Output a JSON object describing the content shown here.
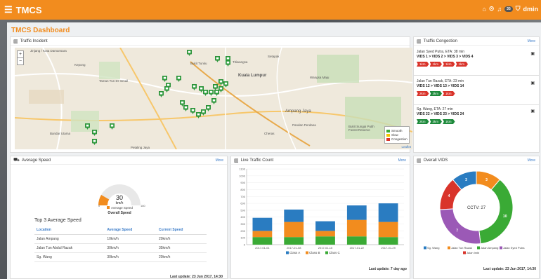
{
  "app": {
    "title": "TMCS",
    "user": "dmin",
    "notif_count": "35"
  },
  "page": {
    "title": "TMCS Dashboard"
  },
  "incident": {
    "title": "Traffic Incident",
    "map_labels": [
      "Jinjang / Kota Damansara",
      "Kuala Lumpur",
      "Ampang Jaya",
      "Petaling Jaya",
      "Taman Tun Dr Ismail",
      "Bukit Tunku",
      "Setapak",
      "Cheras",
      "Titiwangsa",
      "Pandan Perdana",
      "Bukit Sungai Putih Forest Reserve",
      "Kepong",
      "Wangsa Maju",
      "Bandar Utama"
    ],
    "legend": [
      {
        "label": "Smooth",
        "color": "#3aaa35"
      },
      {
        "label": "Slow",
        "color": "#f2c500"
      },
      {
        "label": "Congestion",
        "color": "#d9342b"
      }
    ],
    "attribution": "Leaflet"
  },
  "congestion": {
    "title": "Traffic Congestion",
    "more": "More",
    "items": [
      {
        "title": "Jalan Syed Putra, ETA: 38 min",
        "vids": "VIDS 1 >  VIDS 2 >  VIDS 3 >  VIDS 4",
        "segments": [
          {
            "label": "1km",
            "color": "#d9342b"
          },
          {
            "label": "1km",
            "color": "#d9342b"
          },
          {
            "label": "1km",
            "color": "#d9342b"
          },
          {
            "label": "1km",
            "color": "#d9342b"
          }
        ]
      },
      {
        "title": "Jalan Tun Razak, ETA: 23 min",
        "vids": "VIDS 12 >  VIDS 13 >  VIDS 14",
        "segments": [
          {
            "label": "2km",
            "color": "#d9342b"
          },
          {
            "label": "3km",
            "color": "#1e8a3c"
          },
          {
            "label": "1km",
            "color": "#d9342b"
          }
        ]
      },
      {
        "title": "Sg. Wang, ETA: 27 min",
        "vids": "VIDS 22 >  VIDS 23 >  VIDS 24",
        "segments": [
          {
            "label": "2km",
            "color": "#1e8a3c"
          },
          {
            "label": "3km",
            "color": "#1e8a3c"
          },
          {
            "label": "1km",
            "color": "#1e8a3c"
          }
        ]
      }
    ]
  },
  "speed": {
    "title": "Average Speed",
    "more": "More",
    "gauge": {
      "value": "30",
      "unit": "km/h",
      "min": "0",
      "max": "180",
      "fraction": 0.1667,
      "legend": "Average Speed",
      "caption": "Overall Speed"
    },
    "top3_title": "Top 3 Average Speed",
    "columns": [
      "Location",
      "Average Speed",
      "Current Speed"
    ],
    "rows": [
      [
        "Jalan Ampang",
        "10km/h",
        "20km/h"
      ],
      [
        "Jalan Tun Abdul Razak",
        "30km/h",
        "35km/h"
      ],
      [
        "Sg. Wang",
        "30km/h",
        "20km/h"
      ]
    ],
    "updated": "Last update: 23 Jun 2017, 14:30"
  },
  "live": {
    "title": "Live Traffic Count",
    "more": "More",
    "updated": "Last update: 7 day ago"
  },
  "vids": {
    "title": "Overall VIDS",
    "more": "More",
    "center": "CCTV: 27",
    "updated": "Last update: 23 Jun 2017, 14:30"
  },
  "chart_data": [
    {
      "type": "bar",
      "stacked": true,
      "categories": [
        "2017-01-01",
        "2017-01-08",
        "2017-01-15",
        "2017-01-22",
        "2017-01-29"
      ],
      "series": [
        {
          "name": "Class A",
          "color": "#2a7cc1",
          "values": [
            110,
            110,
            120,
            120,
            110
          ]
        },
        {
          "name": "Class B",
          "color": "#f28c1e",
          "values": [
            200,
            330,
            200,
            360,
            330
          ]
        },
        {
          "name": "Class C",
          "color": "#3aaa35",
          "values": [
            390,
            510,
            340,
            570,
            600
          ]
        }
      ],
      "ylim": [
        0,
        1100
      ],
      "yticks": [
        "0",
        "100",
        "200",
        "300",
        "400",
        "500",
        "600",
        "700",
        "800",
        "900",
        "1000",
        "1100"
      ],
      "legend_position": "bottom"
    },
    {
      "type": "pie",
      "donut": true,
      "categories": [
        "Sg. Wang",
        "Jalan Tun Razak",
        "Jalan Ampang",
        "Jalan Syed Putra",
        "Jalan Imbi"
      ],
      "values": [
        3,
        3,
        10,
        7,
        4
      ],
      "colors": [
        "#2a7cc1",
        "#f28c1e",
        "#3aaa35",
        "#9b59b6",
        "#d9342b"
      ],
      "labels": [
        "3",
        "3",
        "10",
        "7",
        "4"
      ],
      "legend_position": "bottom"
    }
  ]
}
